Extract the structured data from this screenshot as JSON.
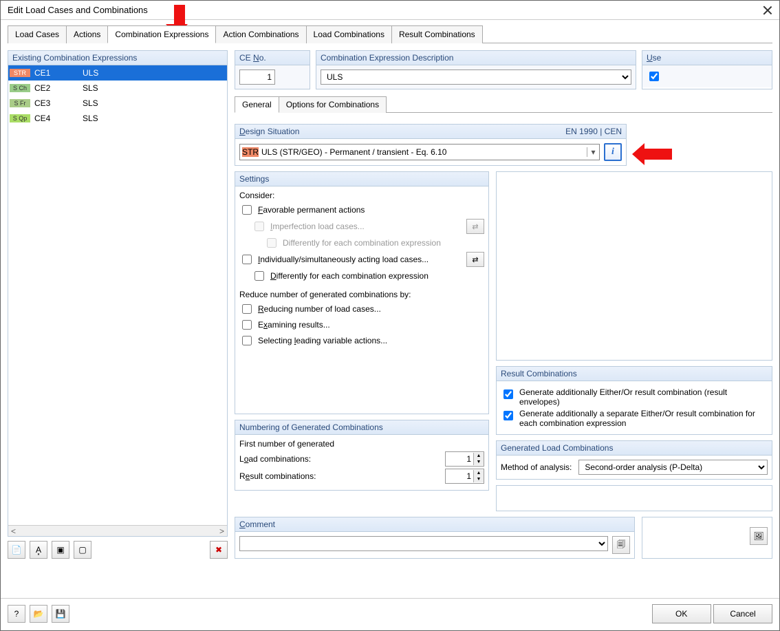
{
  "window": {
    "title": "Edit Load Cases and Combinations"
  },
  "tabs": {
    "items": [
      "Load Cases",
      "Actions",
      "Combination Expressions",
      "Action Combinations",
      "Load Combinations",
      "Result Combinations"
    ],
    "active_index": 2
  },
  "left": {
    "title": "Existing Combination Expressions",
    "rows": [
      {
        "badge": "STR",
        "badge_cls": "str",
        "id": "CE1",
        "desc": "ULS",
        "selected": true
      },
      {
        "badge": "S Ch",
        "badge_cls": "sch",
        "id": "CE2",
        "desc": "SLS",
        "selected": false
      },
      {
        "badge": "S Fr",
        "badge_cls": "sfr",
        "id": "CE3",
        "desc": "SLS",
        "selected": false
      },
      {
        "badge": "S Qp",
        "badge_cls": "sqp",
        "id": "CE4",
        "desc": "SLS",
        "selected": false
      }
    ],
    "toolbar": {
      "new": "new-ce",
      "rename": "rename",
      "opts": "options",
      "dup": "duplicate",
      "del": "delete"
    }
  },
  "topfields": {
    "ce_no_label_pre": "CE ",
    "ce_no_label_und": "N",
    "ce_no_label_post": "o.",
    "ce_no_value": "1",
    "desc_label": "Combination Expression Description",
    "desc_value": "ULS",
    "use_label_und": "U",
    "use_label_post": "se",
    "use_checked": true
  },
  "subtabs": {
    "items": [
      "General",
      "Options for Combinations"
    ],
    "active": 0
  },
  "design": {
    "title_und": "D",
    "title_post": "esign Situation",
    "standard": "EN 1990 | CEN",
    "badge": "STR",
    "text": "ULS (STR/GEO) - Permanent / transient - Eq. 6.10"
  },
  "settings": {
    "title": "Settings",
    "consider": "Consider:",
    "favorable_und": "F",
    "favorable_post": "avorable permanent actions",
    "imperfection_und": "I",
    "imperfection_post": "mperfection load cases...",
    "diff1": "Differently for each combination expression",
    "indiv_und": "I",
    "indiv_post": "ndividually/simultaneously acting load cases...",
    "diff2_und": "D",
    "diff2_post": "ifferently for each combination expression",
    "reduce": "Reduce number of generated combinations by:",
    "reducing_und": "R",
    "reducing_post": "educing number of load cases...",
    "examining": "E",
    "examining_und": "x",
    "examining_post": "amining results...",
    "selecting": "Selecting ",
    "selecting_und": "l",
    "selecting_post": "eading variable actions..."
  },
  "result_combos": {
    "title": "Result Combinations",
    "gen1": "Generate additionally Either/Or result combination (result envelopes)",
    "gen2": "Generate additionally a separate Either/Or result combination for each combination expression",
    "gen1_checked": true,
    "gen2_checked": true
  },
  "gen_load": {
    "title": "Generated Load Combinations",
    "method_label": "Method of analysis:",
    "method_value": "Second-order analysis (P-Delta)"
  },
  "numbering": {
    "title": "Numbering of Generated Combinations",
    "first_label": "First number of generated",
    "load_pre": "L",
    "load_und": "o",
    "load_post": "ad combinations:",
    "load_value": "1",
    "result_pre": "R",
    "result_und": "e",
    "result_post": "sult combinations:",
    "result_value": "1"
  },
  "comment": {
    "title_und": "C",
    "title_post": "omment",
    "value": ""
  },
  "footer": {
    "ok": "OK",
    "cancel": "Cancel"
  }
}
